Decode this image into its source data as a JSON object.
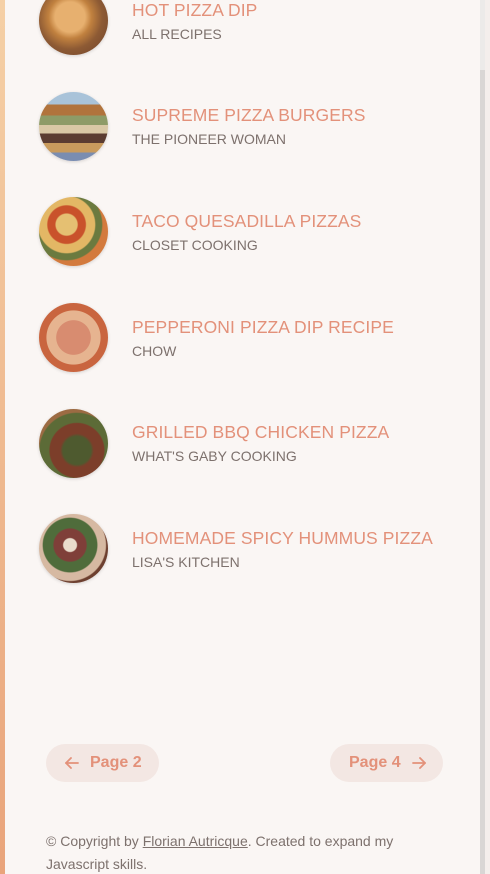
{
  "results": [
    {
      "title": "HOT PIZZA DIP",
      "publisher": "ALL RECIPES"
    },
    {
      "title": "SUPREME PIZZA BURGERS",
      "publisher": "THE PIONEER WOMAN"
    },
    {
      "title": "TACO QUESADILLA PIZZAS",
      "publisher": "CLOSET COOKING"
    },
    {
      "title": "PEPPERONI PIZZA DIP RECIPE",
      "publisher": "CHOW"
    },
    {
      "title": "GRILLED BBQ CHICKEN PIZZA",
      "publisher": "WHAT'S GABY COOKING"
    },
    {
      "title": "HOMEMADE SPICY HUMMUS PIZZA",
      "publisher": "LISA'S KITCHEN"
    }
  ],
  "pagination": {
    "prev_label": "Page 2",
    "next_label": "Page 4"
  },
  "footer": {
    "prefix": "© Copyright by ",
    "author": "Florian Autricque",
    "suffix": ". Created to expand my Javascript skills."
  },
  "colors": {
    "accent": "#e3917a",
    "text_muted": "#7d716d",
    "button_bg": "#f3e7e3"
  }
}
